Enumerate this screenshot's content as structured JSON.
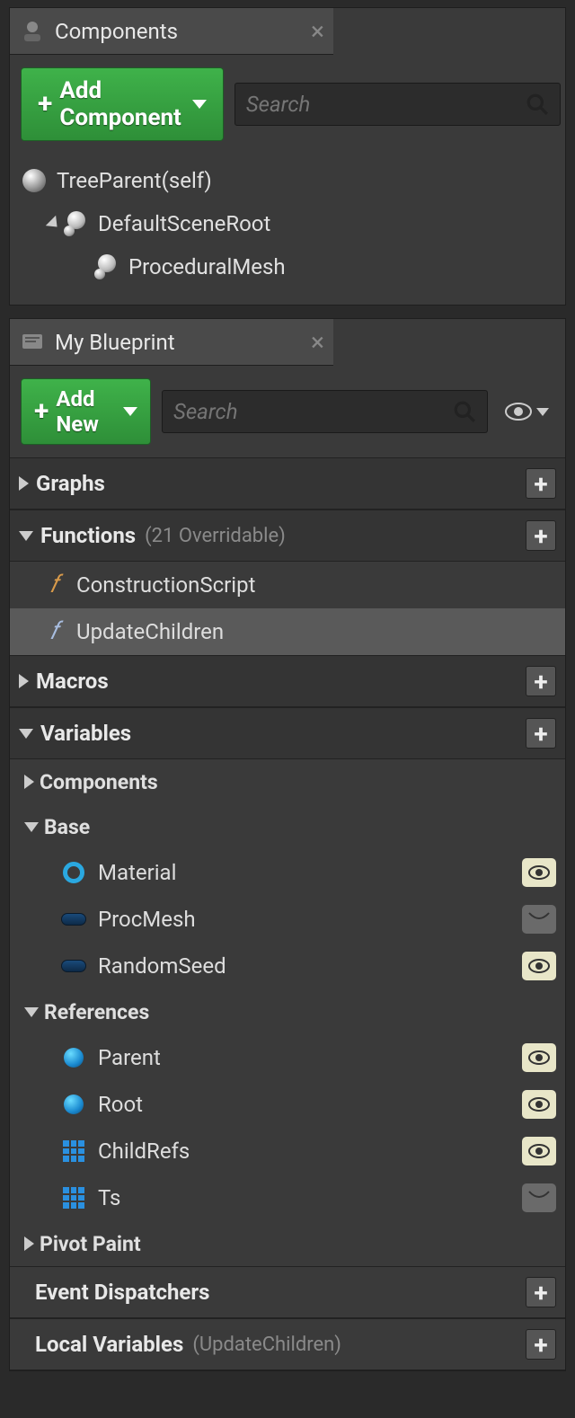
{
  "components_panel": {
    "title": "Components",
    "add_button": "Add Component",
    "search_placeholder": "Search",
    "tree": {
      "root": "TreeParent(self)",
      "scene_root": "DefaultSceneRoot",
      "child": "ProceduralMesh"
    }
  },
  "blueprint_panel": {
    "title": "My Blueprint",
    "add_button": "Add New",
    "search_placeholder": "Search",
    "sections": {
      "graphs": {
        "title": "Graphs"
      },
      "functions": {
        "title": "Functions",
        "subtitle": "(21 Overridable)",
        "items": [
          "ConstructionScript",
          "UpdateChildren"
        ]
      },
      "macros": {
        "title": "Macros"
      },
      "variables": {
        "title": "Variables",
        "groups": {
          "components": "Components",
          "base": {
            "title": "Base",
            "vars": [
              "Material",
              "ProcMesh",
              "RandomSeed"
            ],
            "visible": [
              true,
              false,
              true
            ]
          },
          "references": {
            "title": "References",
            "vars": [
              "Parent",
              "Root",
              "ChildRefs",
              "Ts"
            ],
            "visible": [
              true,
              true,
              true,
              false
            ]
          },
          "pivot_paint": "Pivot Paint"
        }
      },
      "event_dispatchers": {
        "title": "Event Dispatchers"
      },
      "local_variables": {
        "title": "Local Variables",
        "subtitle": "(UpdateChildren)"
      }
    }
  }
}
